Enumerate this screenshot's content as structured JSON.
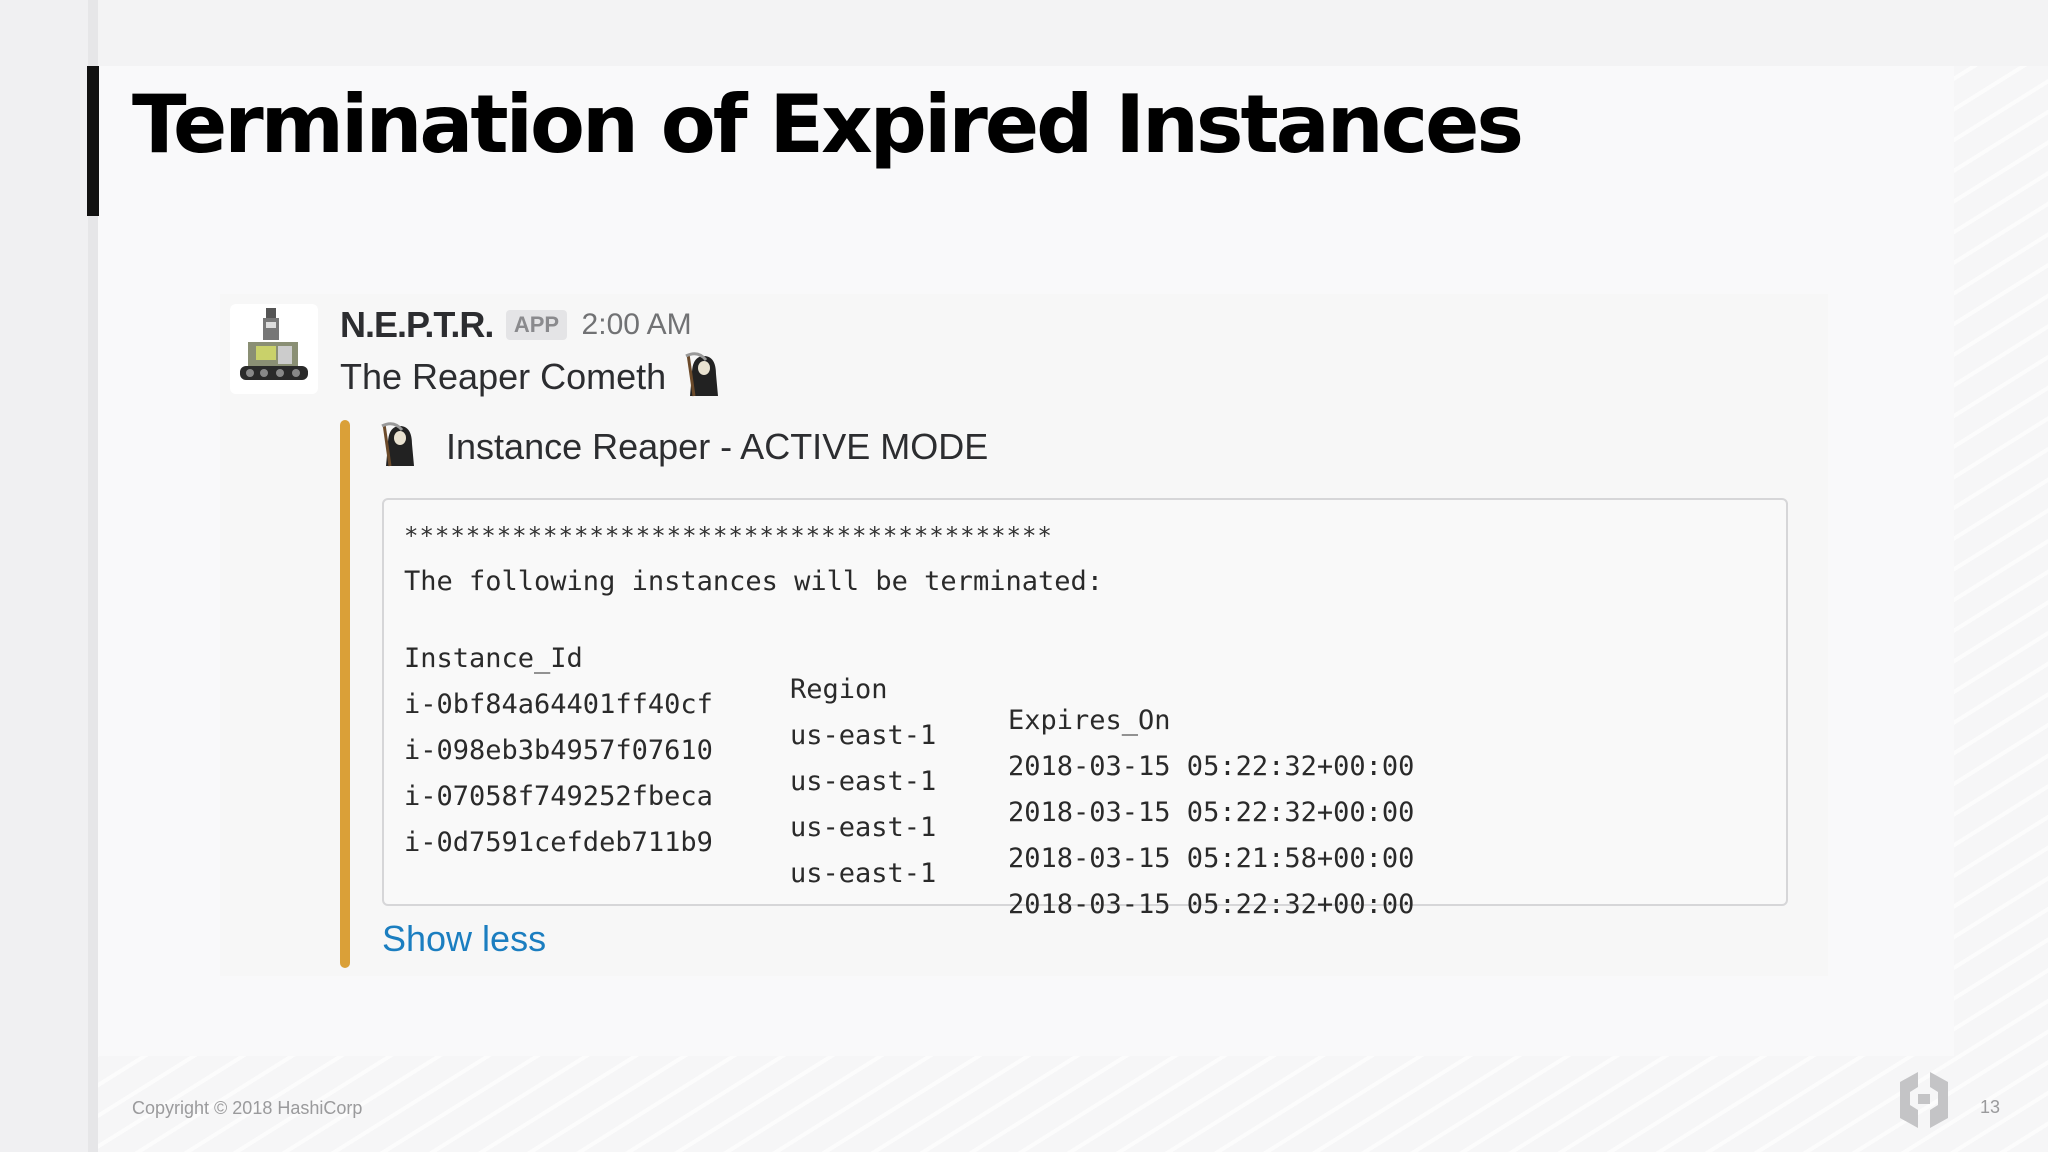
{
  "slide": {
    "title": "Termination of Expired Instances",
    "footer_copyright": "Copyright © 2018 HashiCorp",
    "page_number": "13"
  },
  "message": {
    "author": "N.E.P.T.R.",
    "badge": "APP",
    "time": "2:00 AM",
    "text": "The Reaper Cometh",
    "attachment": {
      "title": "Instance Reaper - ACTIVE MODE",
      "accent_color": "#daa038",
      "code": {
        "stars": "******************************************",
        "intro": "The following instances will be terminated:",
        "headers": {
          "id": "Instance_Id",
          "region": "Region",
          "expires": "Expires_On"
        },
        "rows": [
          {
            "id": "i-0bf84a64401ff40cf",
            "region": "us-east-1",
            "expires": "2018-03-15 05:22:32+00:00"
          },
          {
            "id": "i-098eb3b4957f07610",
            "region": "us-east-1",
            "expires": "2018-03-15 05:22:32+00:00"
          },
          {
            "id": "i-07058f749252fbeca",
            "region": "us-east-1",
            "expires": "2018-03-15 05:21:58+00:00"
          },
          {
            "id": "i-0d7591cefdeb711b9",
            "region": "us-east-1",
            "expires": "2018-03-15 05:22:32+00:00"
          }
        ]
      },
      "toggle_label": "Show less"
    }
  },
  "icons": {
    "avatar": "robot-avatar-icon",
    "emoji": "grim-reaper-icon",
    "logo": "hashicorp-logo-icon"
  }
}
